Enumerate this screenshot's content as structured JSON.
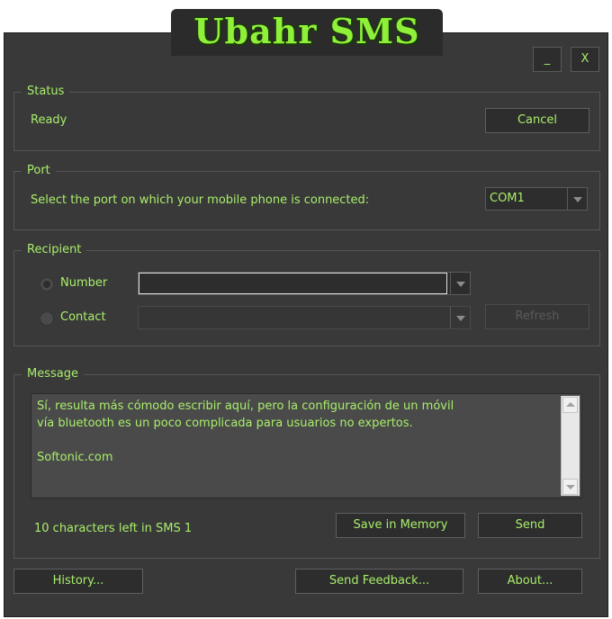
{
  "app": {
    "title": "Ubahr SMS"
  },
  "window_buttons": {
    "minimize": "_",
    "close": "X"
  },
  "status": {
    "legend": "Status",
    "text": "Ready",
    "cancel_label": "Cancel"
  },
  "port": {
    "legend": "Port",
    "instruction": "Select the port on which your mobile phone is connected:",
    "selected": "COM1"
  },
  "recipient": {
    "legend": "Recipient",
    "number_label": "Number",
    "number_value": "",
    "contact_label": "Contact",
    "contact_value": "",
    "refresh_label": "Refresh",
    "selected": "number"
  },
  "message": {
    "legend": "Message",
    "text": "Sí, resulta más cómodo escribir aquí, pero la configuración de un móvil\nvía bluetooth es un poco complicada para usuarios no expertos.\n\nSoftonic.com",
    "chars_left": "10 characters left in SMS 1",
    "save_label": "Save in Memory",
    "send_label": "Send"
  },
  "footer": {
    "history_label": "History...",
    "feedback_label": "Send Feedback...",
    "about_label": "About..."
  },
  "colors": {
    "background": "#393939",
    "text": "#a8ee6a",
    "control": "#2d2d2d",
    "border": "#555555"
  }
}
